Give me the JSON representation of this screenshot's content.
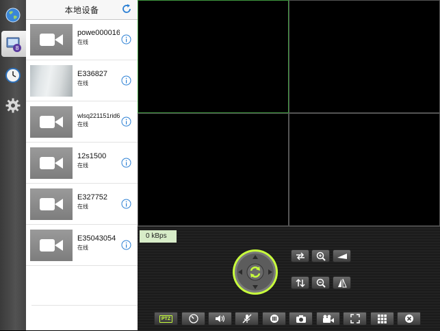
{
  "sidebar": {
    "items": [
      {
        "name": "globe-icon",
        "selected": false
      },
      {
        "name": "device-list-icon",
        "selected": true
      },
      {
        "name": "clock-icon",
        "selected": false
      },
      {
        "name": "gear-icon",
        "selected": false
      }
    ]
  },
  "device_panel": {
    "title": "本地设备",
    "devices": [
      {
        "name": "powe000016",
        "status": "在线",
        "thumbnail": "camera-placeholder"
      },
      {
        "name": "E336827",
        "status": "在线",
        "thumbnail": "snapshot"
      },
      {
        "name": "wlsq221151rid6",
        "status": "在线",
        "thumbnail": "camera-placeholder"
      },
      {
        "name": "12s1500",
        "status": "在线",
        "thumbnail": "camera-placeholder"
      },
      {
        "name": "E327752",
        "status": "在线",
        "thumbnail": "camera-placeholder"
      },
      {
        "name": "E35043054",
        "status": "在线",
        "thumbnail": "camera-placeholder"
      }
    ]
  },
  "video_grid": {
    "layout": "2x2",
    "active_tile": 1
  },
  "control": {
    "bitrate": "0 kBps",
    "ptz_buttons": [
      "swap-horizontal-icon",
      "zoom-in-icon",
      "focus-far-icon",
      "swap-vertical-icon",
      "zoom-out-icon",
      "focus-near-icon"
    ],
    "toolbar": {
      "ptz_label": "PTZ",
      "buttons": [
        "ptz-button",
        "speed-gauge-icon",
        "speaker-icon",
        "mic-off-icon",
        "timer-icon",
        "camera-icon",
        "video-record-icon",
        "fullscreen-icon",
        "grid-layout-icon",
        "close-icon"
      ]
    }
  },
  "colors": {
    "active_tile_border": "#3f9a3f",
    "accent_green": "#c8ff3c",
    "info_blue": "#2a7fd4"
  }
}
